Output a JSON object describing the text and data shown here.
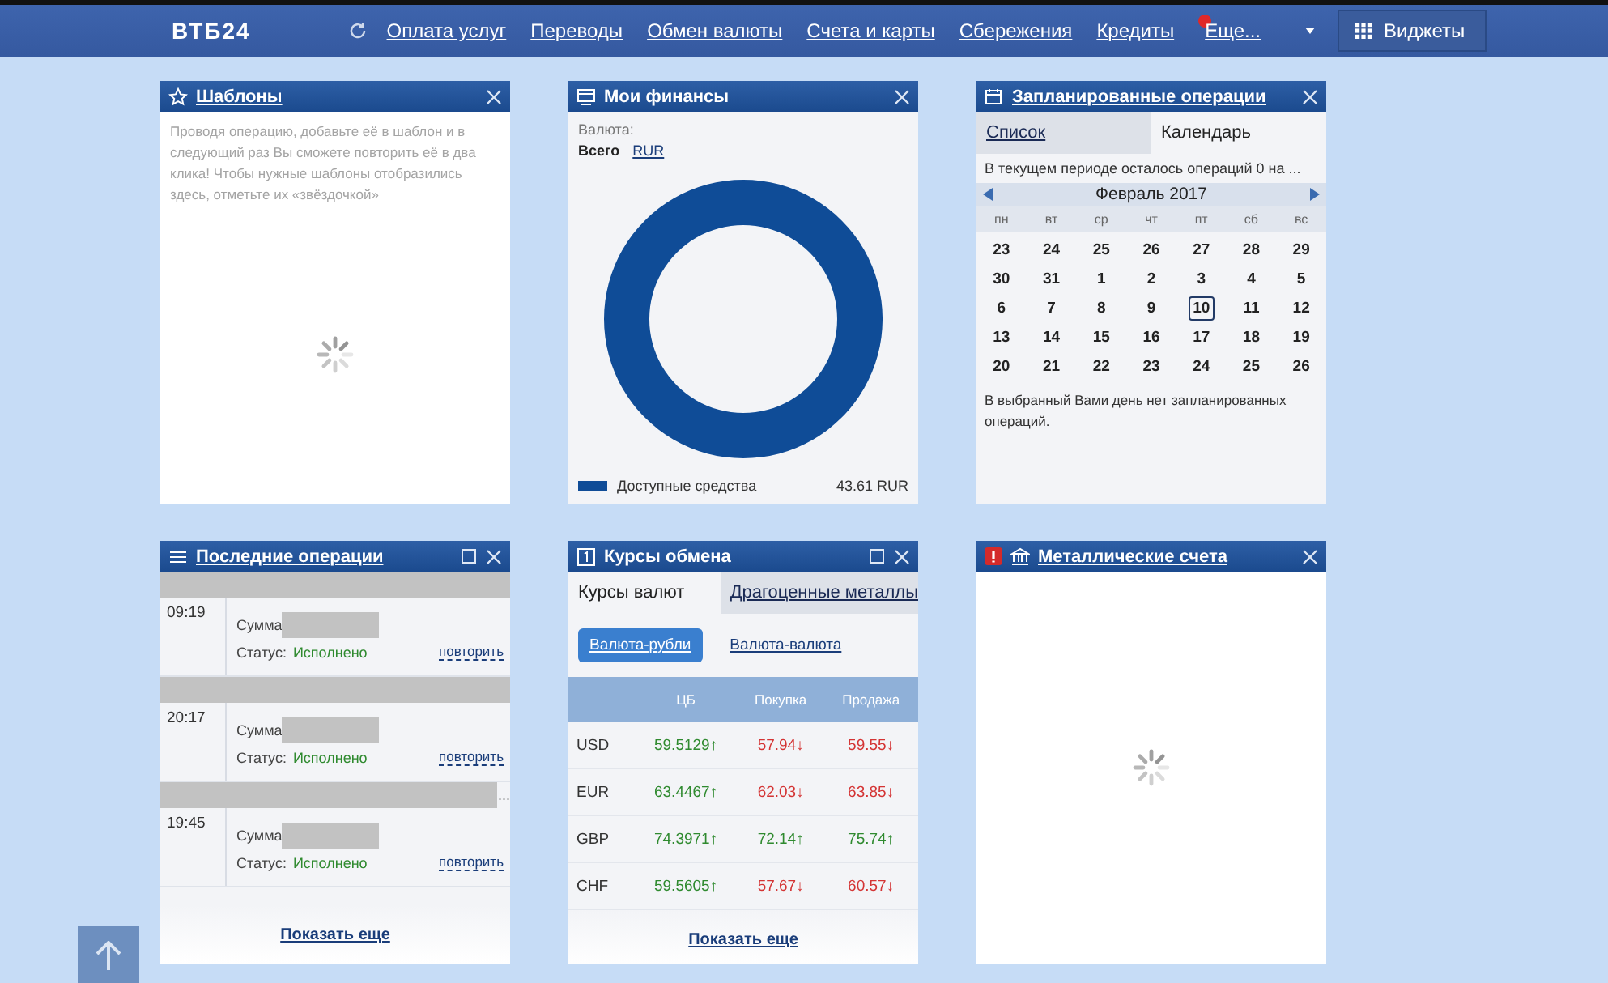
{
  "header": {
    "logo": "ВТБ24",
    "nav": [
      {
        "label": "Оплата услуг"
      },
      {
        "label": "Переводы"
      },
      {
        "label": "Обмен валюты"
      },
      {
        "label": "Счета и карты"
      },
      {
        "label": "Сбережения"
      },
      {
        "label": "Кредиты"
      },
      {
        "label": "Еще...",
        "badge": true,
        "dropdown": true
      }
    ],
    "widgets_button": "Виджеты"
  },
  "widgets": [
    {
      "kind": "templates",
      "title": "Шаблоны",
      "title_link": true,
      "maximize": false,
      "hint": "Проводя операцию, добавьте её в шаблон и в следующий раз Вы сможете повторить её в два клика! Чтобы нужные шаблоны отобразились здесь, отметьте их «звёздочкой»",
      "loading": true
    },
    {
      "kind": "finances",
      "title": "Мои финансы",
      "title_link": false,
      "maximize": false,
      "currency_label": "Валюта:",
      "currency_options": [
        {
          "label": "Всего",
          "selected": true
        },
        {
          "label": "RUR",
          "selected": false
        }
      ],
      "legend": [
        {
          "label": "Доступные средства",
          "value": "43.61 RUR",
          "color": "#0f4c97"
        }
      ]
    },
    {
      "kind": "scheduled",
      "title": "Запланированные операции",
      "title_link": true,
      "maximize": false,
      "tabs": [
        {
          "label": "Список",
          "selected": false
        },
        {
          "label": "Календарь",
          "selected": true
        }
      ],
      "info": "В текущем периоде осталось операций 0 на ...",
      "month": "Февраль 2017",
      "weekdays": [
        "пн",
        "вт",
        "ср",
        "чт",
        "пт",
        "сб",
        "вс"
      ],
      "days": [
        {
          "label": "23",
          "selected": false
        },
        {
          "label": "24",
          "selected": false
        },
        {
          "label": "25",
          "selected": false
        },
        {
          "label": "26",
          "selected": false
        },
        {
          "label": "27",
          "selected": false
        },
        {
          "label": "28",
          "selected": false
        },
        {
          "label": "29",
          "selected": false
        },
        {
          "label": "30",
          "selected": false
        },
        {
          "label": "31",
          "selected": false
        },
        {
          "label": "1",
          "selected": false
        },
        {
          "label": "2",
          "selected": false
        },
        {
          "label": "3",
          "selected": false
        },
        {
          "label": "4",
          "selected": false
        },
        {
          "label": "5",
          "selected": false
        },
        {
          "label": "6",
          "selected": false
        },
        {
          "label": "7",
          "selected": false
        },
        {
          "label": "8",
          "selected": false
        },
        {
          "label": "9",
          "selected": false
        },
        {
          "label": "10",
          "selected": true
        },
        {
          "label": "11",
          "selected": false
        },
        {
          "label": "12",
          "selected": false
        },
        {
          "label": "13",
          "selected": false
        },
        {
          "label": "14",
          "selected": false
        },
        {
          "label": "15",
          "selected": false
        },
        {
          "label": "16",
          "selected": false
        },
        {
          "label": "17",
          "selected": false
        },
        {
          "label": "18",
          "selected": false
        },
        {
          "label": "19",
          "selected": false
        },
        {
          "label": "20",
          "selected": false
        },
        {
          "label": "21",
          "selected": false
        },
        {
          "label": "22",
          "selected": false
        },
        {
          "label": "23",
          "selected": false
        },
        {
          "label": "24",
          "selected": false
        },
        {
          "label": "25",
          "selected": false
        },
        {
          "label": "26",
          "selected": false
        }
      ],
      "note": "В выбранный Вами день нет запланированных операций."
    },
    {
      "kind": "recent",
      "title": "Последние операции",
      "title_link": true,
      "maximize": true,
      "operations": [
        {
          "time": "09:19",
          "amount_label": "Сумма",
          "status_label": "Статус:",
          "status": "Исполнено",
          "action": "повторить"
        },
        {
          "time": "20:17",
          "amount_label": "Сумма",
          "status_label": "Статус:",
          "status": "Исполнено",
          "action": "повторить"
        },
        {
          "time": "19:45",
          "title_suffix": "...",
          "amount_label": "Сумма",
          "status_label": "Статус:",
          "status": "Исполнено",
          "action": "повторить"
        }
      ],
      "more": "Показать еще"
    },
    {
      "kind": "rates",
      "title": "Курсы обмена",
      "title_link": false,
      "maximize": true,
      "tabs": [
        {
          "label": "Курсы валют",
          "selected": true
        },
        {
          "label": "Драгоценные металлы",
          "selected": false
        }
      ],
      "modes": [
        {
          "label": "Валюта-рубли",
          "selected": true
        },
        {
          "label": "Валюта-валюта",
          "selected": false
        }
      ],
      "columns": [
        "ЦБ",
        "Покупка",
        "Продажа"
      ],
      "rows": [
        {
          "code": "USD",
          "cells": [
            {
              "value": "59.5129↑",
              "rising": true
            },
            {
              "value": "57.94↓",
              "rising": false
            },
            {
              "value": "59.55↓",
              "rising": false
            }
          ]
        },
        {
          "code": "EUR",
          "cells": [
            {
              "value": "63.4467↑",
              "rising": true
            },
            {
              "value": "62.03↓",
              "rising": false
            },
            {
              "value": "63.85↓",
              "rising": false
            }
          ]
        },
        {
          "code": "GBP",
          "cells": [
            {
              "value": "74.3971↑",
              "rising": true
            },
            {
              "value": "72.14↑",
              "rising": true
            },
            {
              "value": "75.74↑",
              "rising": true
            }
          ]
        },
        {
          "code": "CHF",
          "cells": [
            {
              "value": "59.5605↑",
              "rising": true
            },
            {
              "value": "57.67↓",
              "rising": false
            },
            {
              "value": "60.57↓",
              "rising": false
            }
          ]
        }
      ],
      "more": "Показать еще"
    },
    {
      "kind": "metals",
      "title": "Металлические счета",
      "title_link": true,
      "maximize": false,
      "warning": true,
      "loading": true
    }
  ]
}
